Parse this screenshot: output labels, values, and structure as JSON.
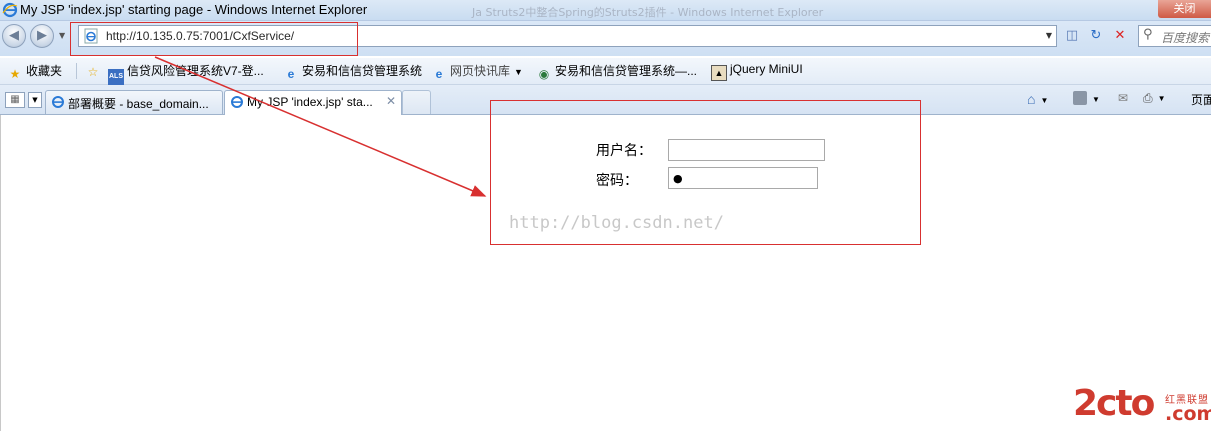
{
  "window": {
    "title": "My JSP 'index.jsp' starting page - Windows Internet Explorer",
    "background_tab_ghost": "Ja Struts2中整合Spring的Struts2插件 - Windows Internet Explorer",
    "close_label": "关闭"
  },
  "address_bar": {
    "url": "http://10.135.0.75:7001/CxfService/",
    "search_placeholder": "百度搜索"
  },
  "favorites": {
    "label": "收藏夹",
    "items": [
      {
        "label": "信贷风险管理系统V7-登...",
        "icon": "als-icon"
      },
      {
        "label": "安易和信信贷管理系统",
        "icon": "ie-page-icon"
      },
      {
        "label": "网页快讯库",
        "icon": "ie-page-icon"
      },
      {
        "label": "安易和信信贷管理系统—...",
        "icon": "globe-icon"
      },
      {
        "label": "jQuery MiniUI",
        "icon": "image-icon"
      }
    ]
  },
  "tabs": [
    {
      "label": "部署概要 - base_domain...",
      "active": false
    },
    {
      "label": "My JSP 'index.jsp' sta...",
      "active": true
    }
  ],
  "command_bar": {
    "page_label": "页面"
  },
  "form": {
    "username_label": "用户名：",
    "username_value": "",
    "password_label": "密码：",
    "password_value": "●"
  },
  "watermark": "http://blog.csdn.net/",
  "logo": {
    "main": "2cto",
    "top": "红黑联盟",
    "bottom": ".com"
  },
  "colors": {
    "annotation_red": "#d83030",
    "chrome_blue": "#cedff3"
  }
}
